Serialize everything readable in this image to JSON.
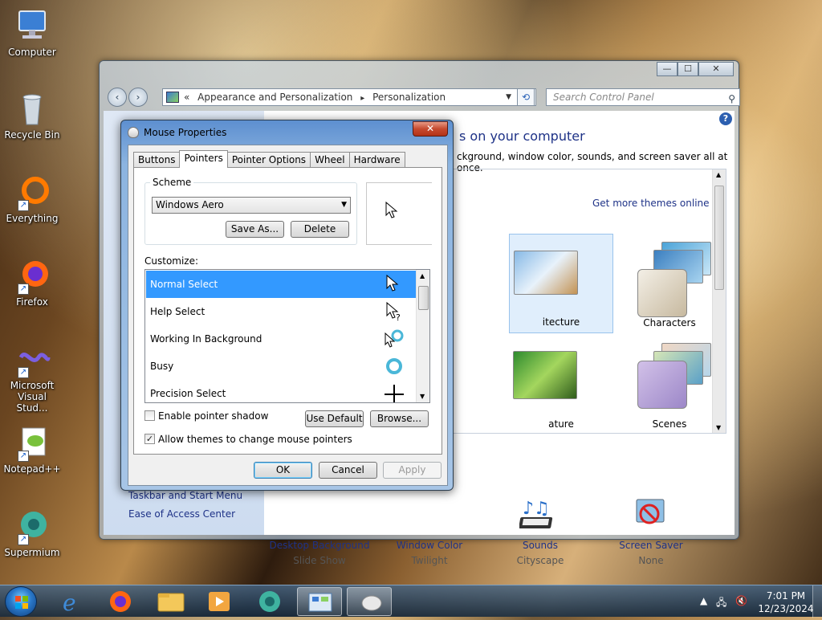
{
  "desktop": {
    "icons": [
      {
        "label": "Computer",
        "icon": "computer-icon"
      },
      {
        "label": "Recycle Bin",
        "icon": "recycle-bin-icon"
      },
      {
        "label": "Everything",
        "icon": "everything-icon"
      },
      {
        "label": "Firefox",
        "icon": "firefox-icon"
      },
      {
        "label": "Microsoft Visual Stud...",
        "icon": "visual-studio-icon"
      },
      {
        "label": "Notepad++",
        "icon": "notepadpp-icon"
      },
      {
        "label": "Supermium",
        "icon": "supermium-icon"
      }
    ]
  },
  "control_panel": {
    "breadcrumb_prefix": "«",
    "breadcrumb_1": "Appearance and Personalization",
    "breadcrumb_sep": "▸",
    "breadcrumb_2": "Personalization",
    "search_placeholder": "Search Control Panel",
    "heading_partial": "s on your computer",
    "subtext_partial": "ckground, window color, sounds, and screen saver all at once.",
    "get_more_link": "Get more themes online",
    "themes": [
      {
        "label": "itecture"
      },
      {
        "label": "Characters"
      },
      {
        "label": "ature"
      },
      {
        "label": "Scenes"
      }
    ],
    "left_links": [
      "Taskbar and Start Menu",
      "Ease of Access Center"
    ],
    "bottom_items": [
      {
        "title": "Desktop Background",
        "value": "Slide Show"
      },
      {
        "title": "Window Color",
        "value": "Twilight"
      },
      {
        "title": "Sounds",
        "value": "Cityscape"
      },
      {
        "title": "Screen Saver",
        "value": "None"
      }
    ],
    "help_glyph": "?"
  },
  "dialog": {
    "title": "Mouse Properties",
    "close_glyph": "✕",
    "tabs": [
      "Buttons",
      "Pointers",
      "Pointer Options",
      "Wheel",
      "Hardware"
    ],
    "active_tab": "Pointers",
    "scheme_label": "Scheme",
    "scheme_value": "Windows Aero",
    "save_as_label": "Save As...",
    "delete_label": "Delete",
    "customize_label": "Customize:",
    "pointer_rows": [
      {
        "label": "Normal Select",
        "cursor": "arrow-cursor-icon",
        "selected": true
      },
      {
        "label": "Help Select",
        "cursor": "help-cursor-icon",
        "selected": false
      },
      {
        "label": "Working In Background",
        "cursor": "working-cursor-icon",
        "selected": false
      },
      {
        "label": "Busy",
        "cursor": "busy-cursor-icon",
        "selected": false
      },
      {
        "label": "Precision Select",
        "cursor": "crosshair-cursor-icon",
        "selected": false
      }
    ],
    "enable_shadow_label": "Enable pointer shadow",
    "enable_shadow_checked": false,
    "allow_themes_label": "Allow themes to change mouse pointers",
    "allow_themes_checked": true,
    "use_default_label": "Use Default",
    "browse_label": "Browse...",
    "ok_label": "OK",
    "cancel_label": "Cancel",
    "apply_label": "Apply"
  },
  "taskbar": {
    "time": "7:01 PM",
    "date": "12/23/2024"
  }
}
